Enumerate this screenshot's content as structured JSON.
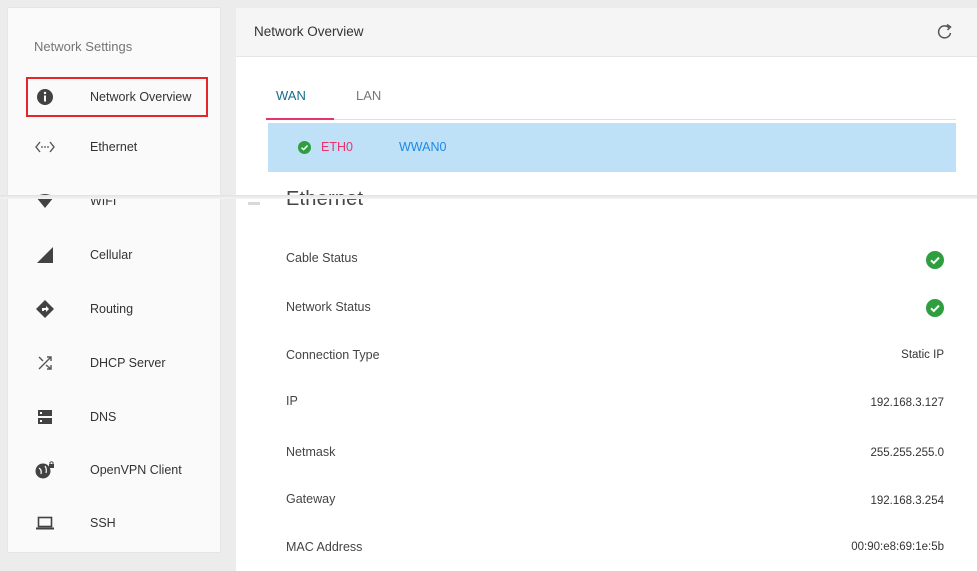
{
  "sidebar": {
    "title": "Network Settings",
    "items": [
      {
        "label": "Network Overview",
        "icon": "info-icon"
      },
      {
        "label": "Ethernet",
        "icon": "ethernet-icon"
      },
      {
        "label": "WIFI",
        "icon": "wifi-icon"
      },
      {
        "label": "Cellular",
        "icon": "cellular-icon"
      },
      {
        "label": "Routing",
        "icon": "routing-icon"
      },
      {
        "label": "DHCP Server",
        "icon": "shuffle-icon"
      },
      {
        "label": "DNS",
        "icon": "dns-icon"
      },
      {
        "label": "OpenVPN Client",
        "icon": "vpn-globe-icon"
      },
      {
        "label": "SSH",
        "icon": "laptop-icon"
      }
    ]
  },
  "header": {
    "title": "Network Overview",
    "refresh_icon": "refresh-icon"
  },
  "tabs": {
    "wan": "WAN",
    "lan": "LAN"
  },
  "interfaces": {
    "eth0": "ETH0",
    "wwan0": "WWAN0"
  },
  "section": {
    "title": "Ethernet"
  },
  "rows": [
    {
      "label": "Cable Status",
      "value": "",
      "status": "ok"
    },
    {
      "label": "Network Status",
      "value": "",
      "status": "ok"
    },
    {
      "label": "Connection Type",
      "value": "Static IP"
    },
    {
      "label": "IP",
      "value": "192.168.3.127"
    },
    {
      "label": "Netmask",
      "value": "255.255.255.0"
    },
    {
      "label": "Gateway",
      "value": "192.168.3.254"
    },
    {
      "label": "MAC Address",
      "value": "00:90:e8:69:1e:5b"
    }
  ],
  "colors": {
    "accent_pink": "#e8336e",
    "link_blue": "#1e88e5",
    "subbar_bg": "#bfe1f7",
    "ok_green": "#2e9e3f",
    "highlight_red": "#e4252b"
  }
}
